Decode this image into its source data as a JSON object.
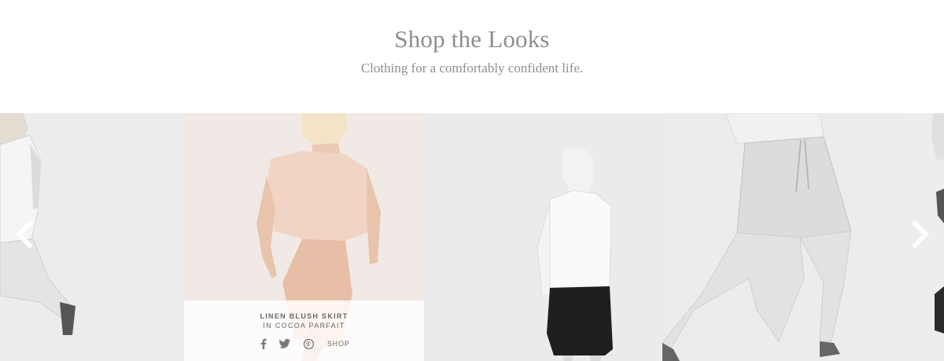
{
  "header": {
    "title": "Shop the Looks",
    "subtitle": "Clothing for a comfortably confident life."
  },
  "carousel": {
    "slides": [
      {
        "image": "model in white tee and speckled pants"
      },
      {
        "image": "model in blush top and linen blush skirt",
        "product": {
          "name": "LINEN BLUSH SKIRT",
          "color": "IN COCOA PARFAIT"
        },
        "social": [
          "facebook-icon",
          "twitter-icon",
          "pinterest-icon"
        ],
        "shop_label": "SHOP"
      },
      {
        "image": "model in white top and black skirt"
      },
      {
        "image": "model in gray top and speckled drawstring skirt"
      },
      {
        "image": "partial model figure"
      }
    ],
    "prev_icon": "chevron-left-icon",
    "next_icon": "chevron-right-icon"
  },
  "colors": {
    "title": "#8e8e8e",
    "overlay_text": "#6a6a6a",
    "arrow": "#ffffff"
  }
}
